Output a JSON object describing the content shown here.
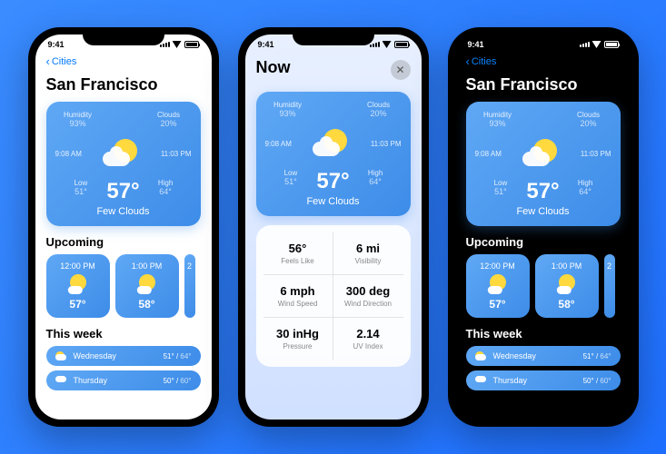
{
  "status_time": "9:41",
  "screens": [
    {
      "mode": "light",
      "back_label": "Cities",
      "title": "San Francisco",
      "card": {
        "humidity_label": "Humidity",
        "humidity": "93%",
        "clouds_label": "Clouds",
        "clouds": "20%",
        "sunrise": "9:08 AM",
        "sunset": "11:03 PM",
        "low_label": "Low",
        "low": "51°",
        "high_label": "High",
        "high": "64°",
        "temp": "57°",
        "condition": "Few Clouds"
      },
      "upcoming_label": "Upcoming",
      "hourly": [
        {
          "time": "12:00 PM",
          "temp": "57°"
        },
        {
          "time": "1:00 PM",
          "temp": "58°"
        },
        {
          "time": "2",
          "temp": ""
        }
      ],
      "week_label": "This week",
      "week": [
        {
          "day": "Wednesday",
          "lo": "51°",
          "hi": "64°"
        },
        {
          "day": "Thursday",
          "lo": "50°",
          "hi": "60°"
        }
      ]
    },
    {
      "mode": "blur",
      "title": "Now",
      "card": {
        "humidity_label": "Humidity",
        "humidity": "93%",
        "clouds_label": "Clouds",
        "clouds": "20%",
        "sunrise": "9:08 AM",
        "sunset": "11:03 PM",
        "low_label": "Low",
        "low": "51°",
        "high_label": "High",
        "high": "64°",
        "temp": "57°",
        "condition": "Few Clouds"
      },
      "details": [
        {
          "value": "56°",
          "label": "Feels Like"
        },
        {
          "value": "6 mi",
          "label": "Visibility"
        },
        {
          "value": "6 mph",
          "label": "Wind Speed"
        },
        {
          "value": "300 deg",
          "label": "Wind Direction"
        },
        {
          "value": "30 inHg",
          "label": "Pressure"
        },
        {
          "value": "2.14",
          "label": "UV Index"
        }
      ]
    },
    {
      "mode": "dark",
      "back_label": "Cities",
      "title": "San Francisco",
      "card": {
        "humidity_label": "Humidity",
        "humidity": "93%",
        "clouds_label": "Clouds",
        "clouds": "20%",
        "sunrise": "9:08 AM",
        "sunset": "11:03 PM",
        "low_label": "Low",
        "low": "51°",
        "high_label": "High",
        "high": "64°",
        "temp": "57°",
        "condition": "Few Clouds"
      },
      "upcoming_label": "Upcoming",
      "hourly": [
        {
          "time": "12:00 PM",
          "temp": "57°"
        },
        {
          "time": "1:00 PM",
          "temp": "58°"
        },
        {
          "time": "2",
          "temp": ""
        }
      ],
      "week_label": "This week",
      "week": [
        {
          "day": "Wednesday",
          "lo": "51°",
          "hi": "64°"
        },
        {
          "day": "Thursday",
          "lo": "50°",
          "hi": "60°"
        }
      ]
    }
  ]
}
